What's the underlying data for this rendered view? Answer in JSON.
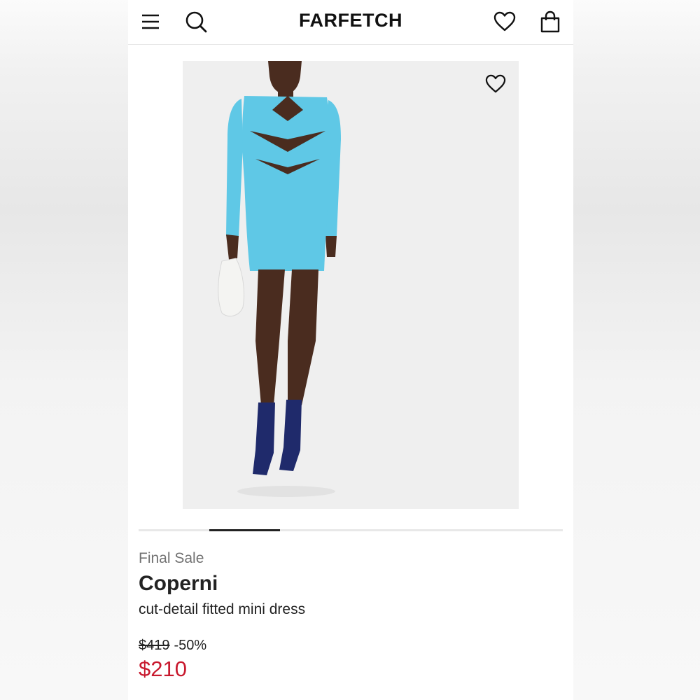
{
  "header": {
    "brand": "FARFETCH",
    "icons": [
      "menu-icon",
      "search-icon",
      "heart-icon",
      "bag-icon"
    ]
  },
  "product": {
    "badge": "Final Sale",
    "brand": "Coperni",
    "name": "cut-detail fitted mini dress",
    "original_price": "$419",
    "discount": "-50%",
    "price": "$210"
  },
  "gallery": {
    "current_index": 2
  },
  "colors": {
    "sale_price": "#c8192e",
    "dress": "#5fc8e6",
    "boots": "#1f2a6b"
  }
}
